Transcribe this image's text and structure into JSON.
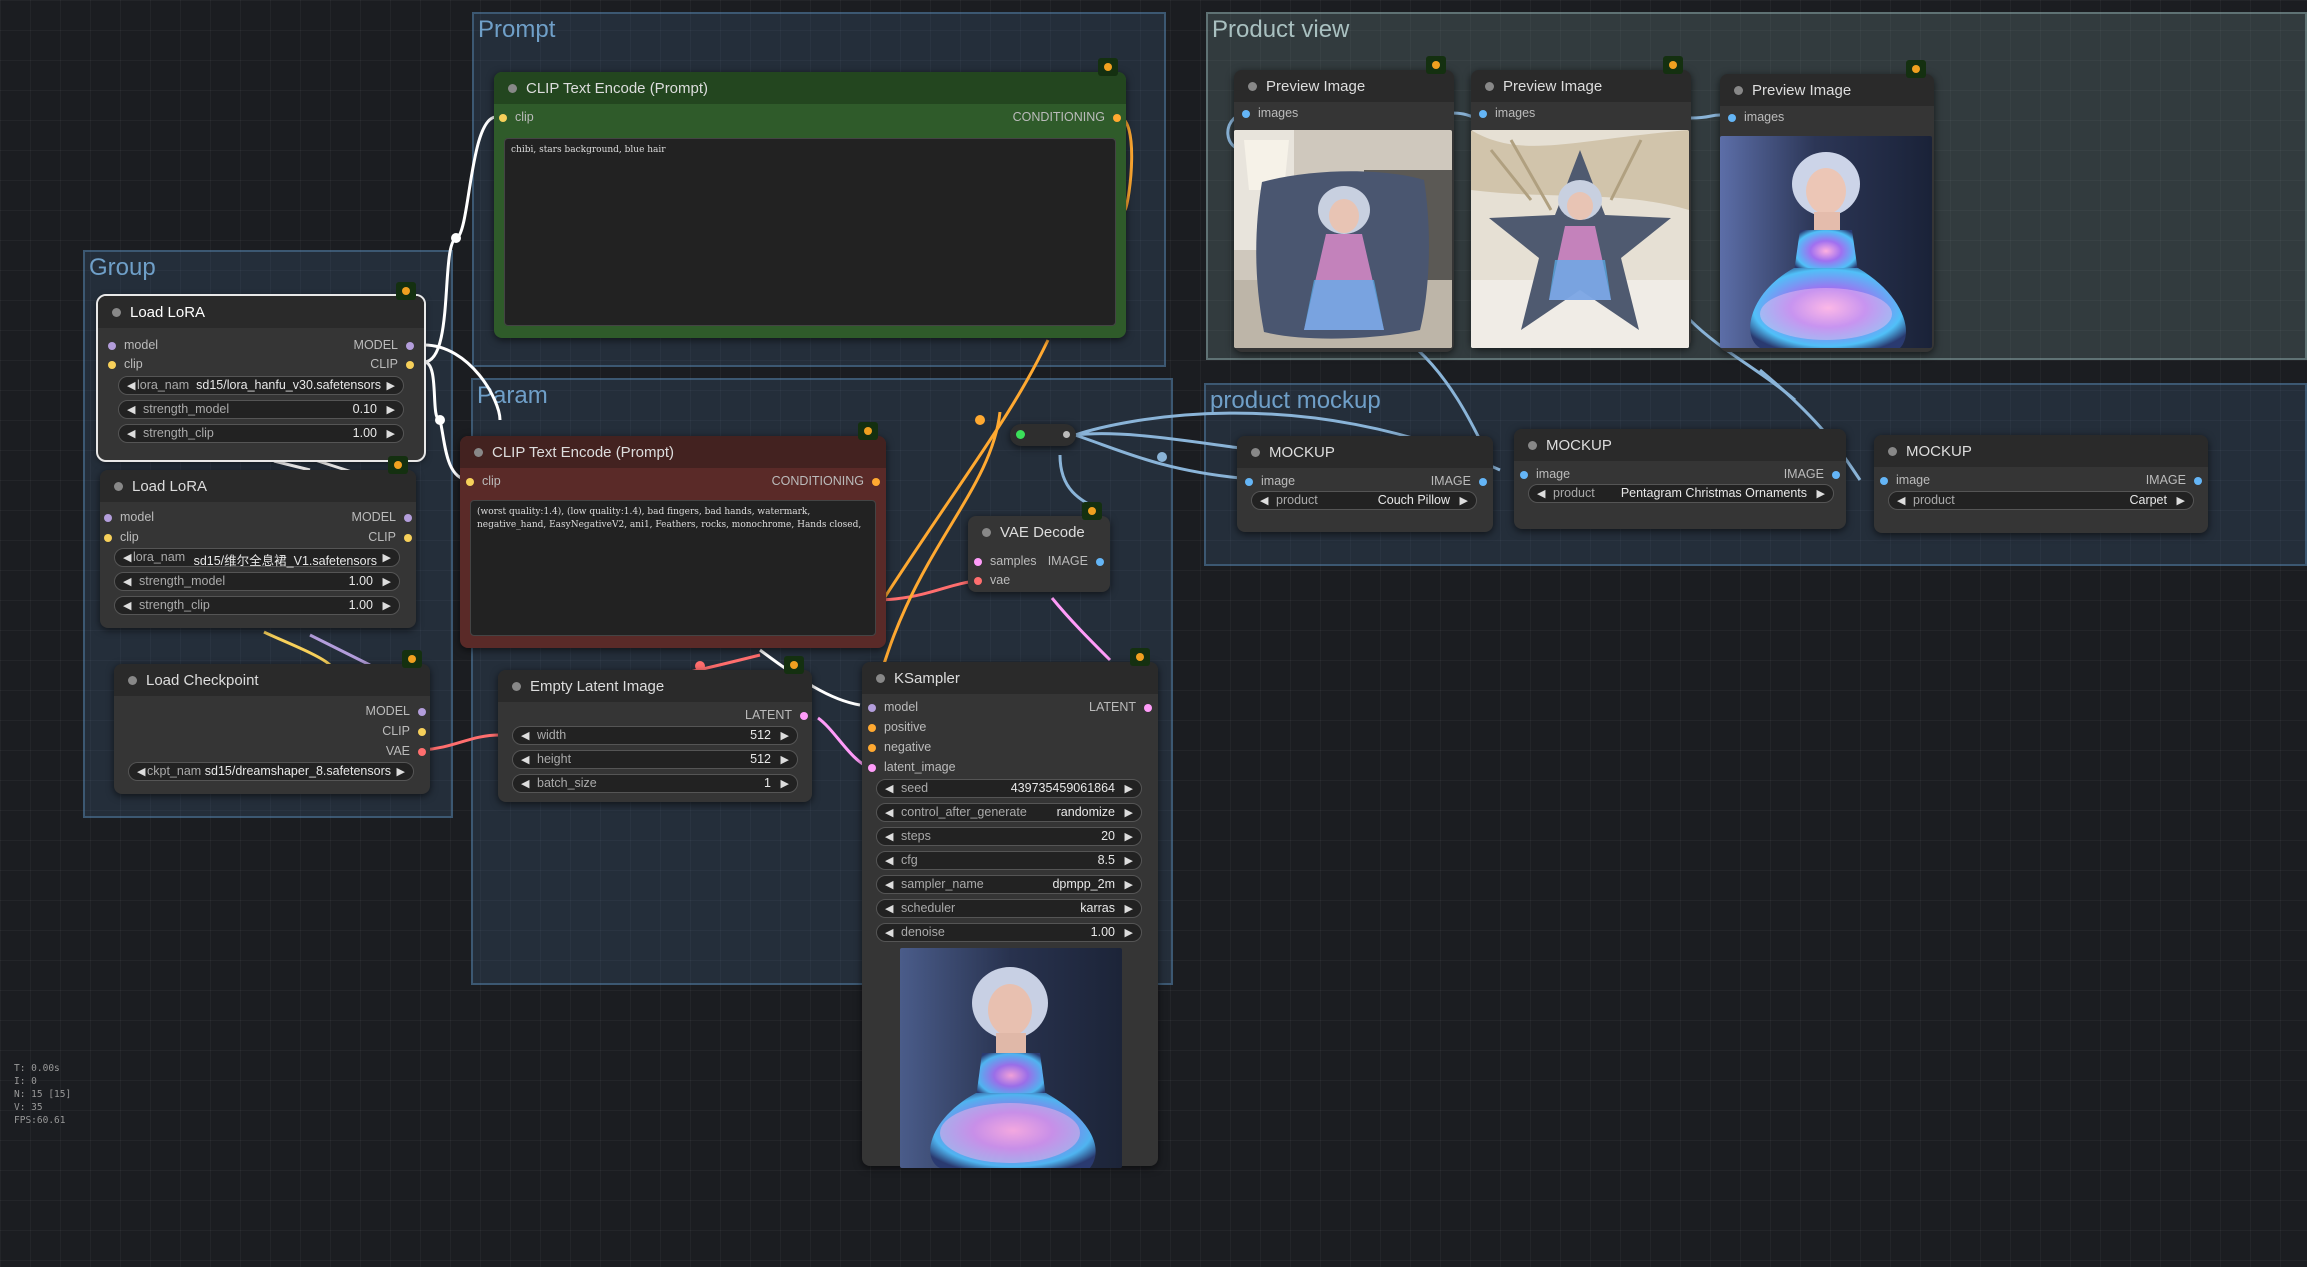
{
  "groups": {
    "prompt": "Prompt",
    "group": "Group",
    "param": "Param",
    "product_view": "Product view",
    "product_mockup": "product mockup"
  },
  "clip_pos": {
    "title": "CLIP Text Encode (Prompt)",
    "in_clip": "clip",
    "out": "CONDITIONING",
    "text": "chibi, stars background, blue hair"
  },
  "clip_neg": {
    "title": "CLIP Text Encode (Prompt)",
    "in_clip": "clip",
    "out": "CONDITIONING",
    "text": "(worst quality:1.4), (low quality:1.4), bad fingers, bad hands, watermark, negative_hand, EasyNegativeV2, ani1, Feathers, rocks, monochrome, Hands closed,"
  },
  "lora1": {
    "title": "Load LoRA",
    "in_model": "model",
    "in_clip": "clip",
    "out_model": "MODEL",
    "out_clip": "CLIP",
    "lora_name_label": "lora_nam",
    "lora_name": "sd15/lora_hanfu_v30.safetensors",
    "strength_model_label": "strength_model",
    "strength_model": "0.10",
    "strength_clip_label": "strength_clip",
    "strength_clip": "1.00"
  },
  "lora2": {
    "title": "Load LoRA",
    "in_model": "model",
    "in_clip": "clip",
    "out_model": "MODEL",
    "out_clip": "CLIP",
    "lora_name_label": "lora_nam",
    "lora_name": "sd15/维尔全息裙_V1.safetensors",
    "strength_model_label": "strength_model",
    "strength_model": "1.00",
    "strength_clip_label": "strength_clip",
    "strength_clip": "1.00"
  },
  "ckpt": {
    "title": "Load Checkpoint",
    "out_model": "MODEL",
    "out_clip": "CLIP",
    "out_vae": "VAE",
    "ckpt_label": "ckpt_nam",
    "ckpt_name": "sd15/dreamshaper_8.safetensors"
  },
  "latent": {
    "title": "Empty Latent Image",
    "out": "LATENT",
    "width_label": "width",
    "width": "512",
    "height_label": "height",
    "height": "512",
    "batch_label": "batch_size",
    "batch": "1"
  },
  "vae_decode": {
    "title": "VAE Decode",
    "in_samples": "samples",
    "in_vae": "vae",
    "out": "IMAGE"
  },
  "ksampler": {
    "title": "KSampler",
    "in_model": "model",
    "in_positive": "positive",
    "in_negative": "negative",
    "in_latent": "latent_image",
    "out": "LATENT",
    "widgets": [
      {
        "label": "seed",
        "value": "439735459061864"
      },
      {
        "label": "control_after_generate",
        "value": "randomize"
      },
      {
        "label": "steps",
        "value": "20"
      },
      {
        "label": "cfg",
        "value": "8.5"
      },
      {
        "label": "sampler_name",
        "value": "dpmpp_2m"
      },
      {
        "label": "scheduler",
        "value": "karras"
      },
      {
        "label": "denoise",
        "value": "1.00"
      }
    ]
  },
  "previews": [
    {
      "title": "Preview Image",
      "in": "images"
    },
    {
      "title": "Preview Image",
      "in": "images"
    },
    {
      "title": "Preview Image",
      "in": "images"
    }
  ],
  "mockups": [
    {
      "title": "MOCKUP",
      "in": "image",
      "out": "IMAGE",
      "label": "product",
      "value": "Couch Pillow"
    },
    {
      "title": "MOCKUP",
      "in": "image",
      "out": "IMAGE",
      "label": "product",
      "value": "Pentagram Christmas Ornaments"
    },
    {
      "title": "MOCKUP",
      "in": "image",
      "out": "IMAGE",
      "label": "product",
      "value": "Carpet"
    }
  ],
  "stats": {
    "t": "T: 0.00s",
    "i": "I: 0",
    "n": "N: 15 [15]",
    "v": "V: 35",
    "fps": "FPS:60.61"
  },
  "colors": {
    "clip": "#f7d05a",
    "model": "#b39ddb",
    "vae": "#ff6e6e",
    "conditioning": "#ffa931",
    "latent": "#ff9cf9",
    "image": "#64b5f6",
    "node_positive": "#2f5b2a",
    "node_negative": "#5a2a28"
  },
  "icons": {
    "node_badge": "comfy-badge-icon",
    "arrow_left": "◀",
    "arrow_right": "▶"
  }
}
